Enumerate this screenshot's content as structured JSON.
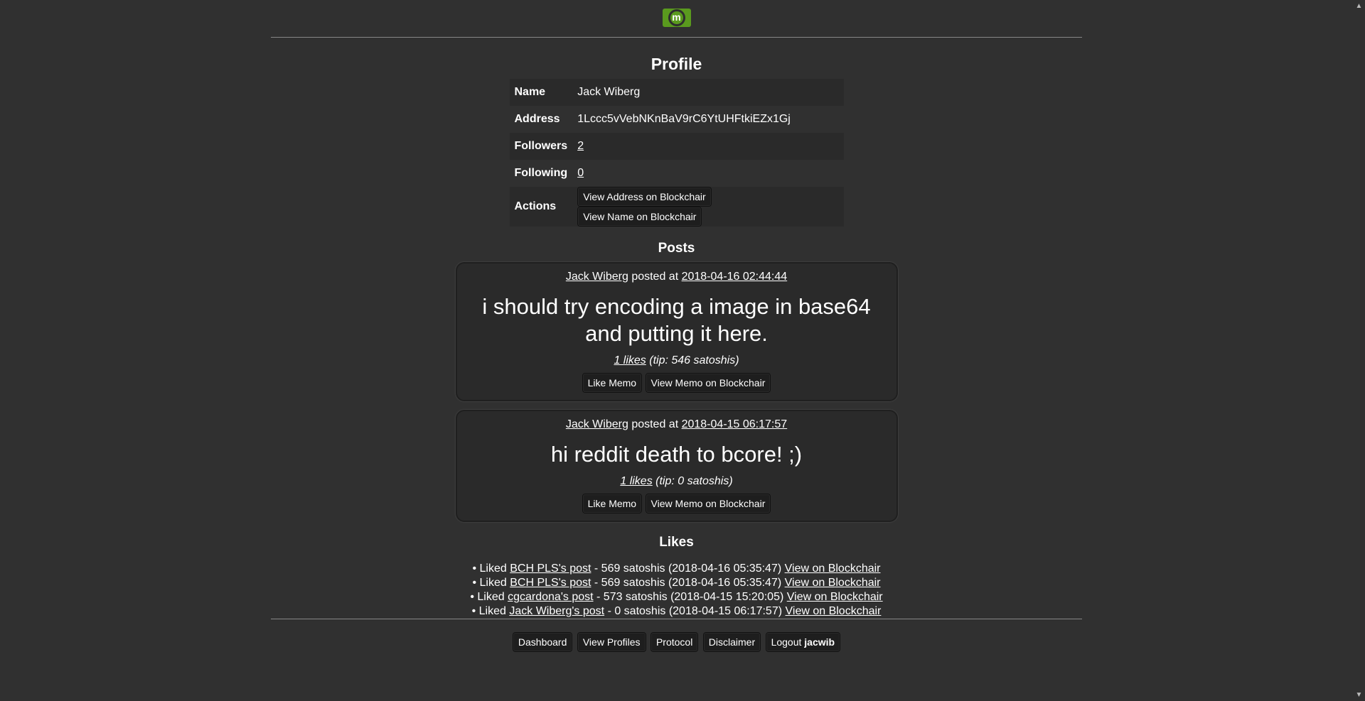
{
  "logo": {
    "letter": "m"
  },
  "profile": {
    "title": "Profile",
    "rows": {
      "name_label": "Name",
      "name_value": "Jack Wiberg",
      "address_label": "Address",
      "address_value": "1Lccc5vVebNKnBaV9rC6YtUHFtkiEZx1Gj",
      "followers_label": "Followers",
      "followers_value": "2",
      "following_label": "Following",
      "following_value": "0",
      "actions_label": "Actions"
    },
    "actions": {
      "view_address": "View Address on Blockchair",
      "view_name": "View Name on Blockchair"
    }
  },
  "posts": {
    "title": "Posts",
    "items": [
      {
        "author": "Jack Wiberg",
        "posted_at_text": "posted at",
        "timestamp": "2018-04-16 02:44:44",
        "text": "i should try encoding a image in base64 and putting it here.",
        "likes": "1 likes",
        "tip": "(tip: 546 satoshis)",
        "like_button": "Like Memo",
        "view_button": "View Memo on Blockchair"
      },
      {
        "author": "Jack Wiberg",
        "posted_at_text": "posted at",
        "timestamp": "2018-04-15 06:17:57",
        "text": "hi reddit death to bcore! ;)",
        "likes": "1 likes",
        "tip": "(tip: 0 satoshis)",
        "like_button": "Like Memo",
        "view_button": "View Memo on Blockchair"
      }
    ]
  },
  "likes": {
    "title": "Likes",
    "items": [
      {
        "prefix": "Liked",
        "post": "BCH PLS's post",
        "detail": "- 569 satoshis (2018-04-16 05:35:47)",
        "link": "View on Blockchair"
      },
      {
        "prefix": "Liked",
        "post": "BCH PLS's post",
        "detail": "- 569 satoshis (2018-04-16 05:35:47)",
        "link": "View on Blockchair"
      },
      {
        "prefix": "Liked",
        "post": "cgcardona's post",
        "detail": "- 573 satoshis (2018-04-15 15:20:05)",
        "link": "View on Blockchair"
      },
      {
        "prefix": "Liked",
        "post": "Jack Wiberg's post",
        "detail": "- 0 satoshis (2018-04-15 06:17:57)",
        "link": "View on Blockchair"
      }
    ]
  },
  "footer": {
    "dashboard": "Dashboard",
    "view_profiles": "View Profiles",
    "protocol": "Protocol",
    "disclaimer": "Disclaimer",
    "logout": "Logout",
    "username": "jacwib"
  },
  "colors": {
    "background": "#303030",
    "brand_green": "#5a9a1e"
  }
}
